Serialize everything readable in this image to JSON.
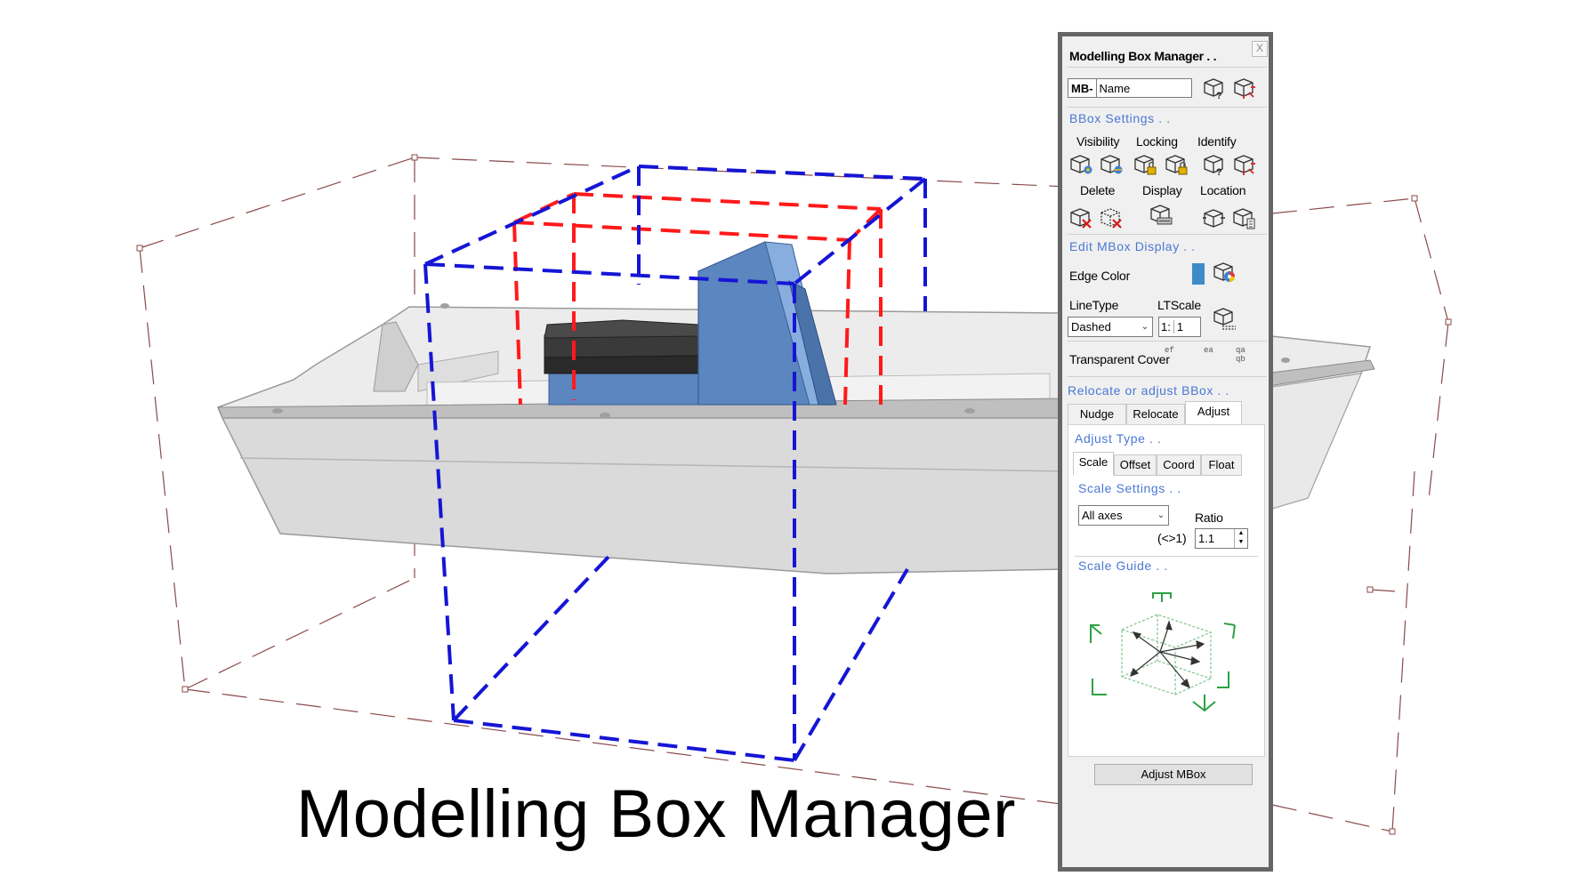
{
  "caption": "Modelling Box Manager",
  "colors": {
    "inner_box": "#1515d6",
    "outer_box": "#ff1a1a",
    "bbox": "#8a4a4a",
    "hull": "#d9d9d9",
    "console": "#5b86bf",
    "section_header": "#4a78d4",
    "edge_color": "#3d8bc9",
    "scale_guide": "#2ea043"
  },
  "panel": {
    "title": "Modelling Box Manager . .",
    "close_label": "X",
    "name_prefix": "MB-",
    "name_value": "Name",
    "bbox_settings": {
      "header": "BBox Settings . .",
      "visibility": "Visibility",
      "locking": "Locking",
      "identify": "Identify",
      "delete": "Delete",
      "display": "Display",
      "location": "Location"
    },
    "edit_display": {
      "header": "Edit MBox Display . .",
      "edge_color": "Edge Color",
      "linetype_label": "LineType",
      "linetype_value": "Dashed",
      "ltscale_label": "LTScale",
      "ltscale_prefix": "1:",
      "ltscale_value": "1",
      "transparent_cover": "Transparent Cover"
    },
    "relocate": {
      "header": "Relocate or adjust BBox . .",
      "tabs": [
        "Nudge",
        "Relocate",
        "Adjust"
      ],
      "active_tab": "Adjust"
    },
    "adjust_type": {
      "header": "Adjust Type . .",
      "tabs": [
        "Scale",
        "Offset",
        "Coord",
        "Float"
      ],
      "active_tab": "Scale"
    },
    "scale_settings": {
      "header": "Scale Settings . .",
      "axes_value": "All axes",
      "ratio_label": "Ratio",
      "ratio_hint": "(<>1)",
      "ratio_value": "1.1"
    },
    "scale_guide": {
      "header": "Scale Guide . ."
    },
    "adjust_button": "Adjust MBox"
  }
}
